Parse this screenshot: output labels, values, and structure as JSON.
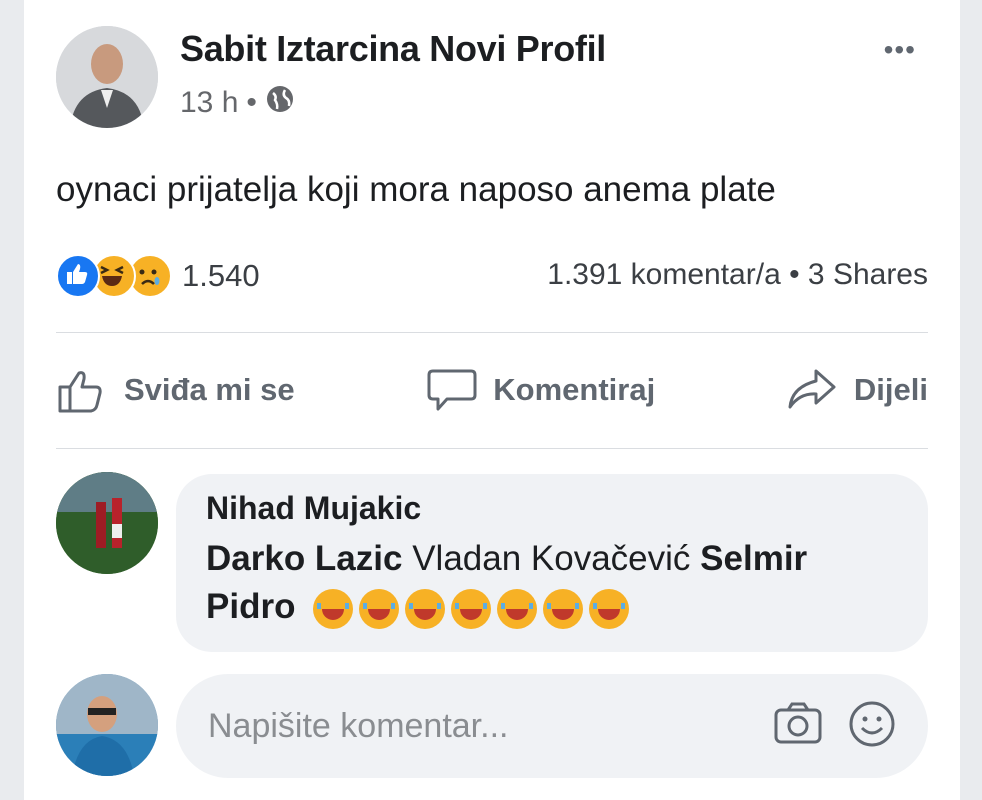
{
  "post": {
    "author": "Sabit Iztarcina Novi Profil",
    "time": "13 h",
    "separator": "•",
    "more_label": "•••",
    "text": "oynaci prijatelja koji mora naposo anema plate",
    "reactions": {
      "types": [
        "like",
        "haha",
        "sad"
      ],
      "count": "1.540"
    },
    "stats": "1.391 komentar/a • 3 Shares"
  },
  "actions": {
    "like_label": "Sviđa mi se",
    "comment_label": "Komentiraj",
    "share_label": "Dijeli"
  },
  "comment": {
    "author": "Nihad Mujakic",
    "mention1": "Darko Lazic",
    "plain": "Vladan Kovačević",
    "mention2_a": "Selmir",
    "mention2_b": "Pidro",
    "emoji_count": 7
  },
  "composer": {
    "placeholder": "Napišite komentar..."
  },
  "colors": {
    "like_blue": "#1877f2",
    "emoji_yellow": "#f7b125",
    "meta_gray": "#65676b"
  },
  "icons": [
    "globe-icon",
    "thumb-up-icon",
    "comment-icon",
    "share-icon",
    "camera-icon",
    "smiley-icon"
  ]
}
